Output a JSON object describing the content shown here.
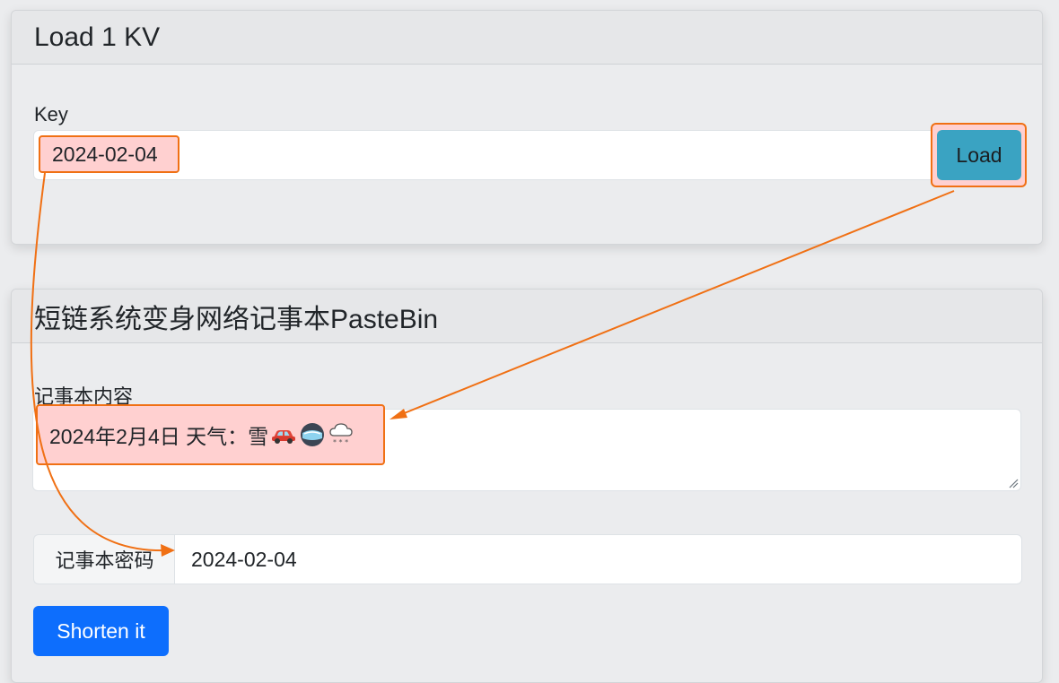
{
  "kv_card": {
    "title": "Load 1 KV",
    "key_label": "Key",
    "key_value": "2024-02-04",
    "load_button": "Load"
  },
  "paste_card": {
    "title": "短链系统变身网络记事本PasteBin",
    "content_label": "记事本内容",
    "content_text": "2024年2月4日 天气：雪",
    "content_emojis": [
      "car-icon",
      "goggles-icon",
      "snow-cloud-icon"
    ],
    "password_label": "记事本密码",
    "password_value": "2024-02-04",
    "submit_button": "Shorten it"
  },
  "colors": {
    "annotation": "#f07014",
    "highlight": "#ffd0d0",
    "load_button": "#3aa3c2",
    "primary": "#0d6efd"
  }
}
